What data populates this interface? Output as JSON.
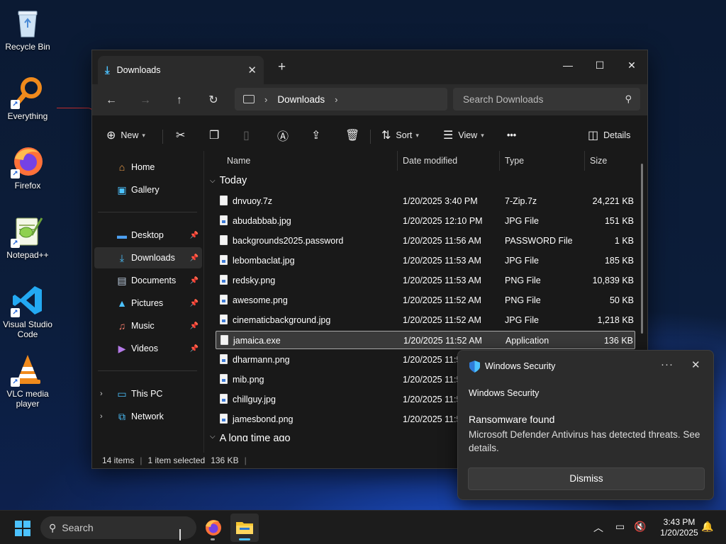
{
  "desktop": {
    "icons": [
      {
        "label": "Recycle Bin",
        "icon": "recycle-bin-icon"
      },
      {
        "label": "Everything",
        "icon": "everything-search-icon"
      },
      {
        "label": "Firefox",
        "icon": "firefox-icon"
      },
      {
        "label": "Notepad++",
        "icon": "notepad-plus-plus-icon"
      },
      {
        "label": "Visual Studio Code",
        "icon": "vscode-icon"
      },
      {
        "label": "VLC media player",
        "icon": "vlc-icon"
      }
    ]
  },
  "explorer": {
    "tab_title": "Downloads",
    "breadcrumb": [
      "Downloads"
    ],
    "search_placeholder": "Search Downloads",
    "toolbar": {
      "new_label": "New",
      "sort_label": "Sort",
      "view_label": "View",
      "details_label": "Details",
      "more_label": "•••"
    },
    "nav": {
      "home": "Home",
      "gallery": "Gallery",
      "desktop": "Desktop",
      "downloads": "Downloads",
      "documents": "Documents",
      "pictures": "Pictures",
      "music": "Music",
      "videos": "Videos",
      "this_pc": "This PC",
      "network": "Network"
    },
    "columns": {
      "name": "Name",
      "date": "Date modified",
      "type": "Type",
      "size": "Size"
    },
    "groups": {
      "today": "Today",
      "older": "A long time ago"
    },
    "files": [
      {
        "name": "dnvuoy.7z",
        "date": "1/20/2025 3:40 PM",
        "type": "7-Zip.7z",
        "size": "24,221 KB",
        "kind": "doc"
      },
      {
        "name": "abudabbab.jpg",
        "date": "1/20/2025 12:10 PM",
        "type": "JPG File",
        "size": "151 KB",
        "kind": "img"
      },
      {
        "name": "backgrounds2025.password",
        "date": "1/20/2025 11:56 AM",
        "type": "PASSWORD File",
        "size": "1 KB",
        "kind": "doc"
      },
      {
        "name": "lebombaclat.jpg",
        "date": "1/20/2025 11:53 AM",
        "type": "JPG File",
        "size": "185 KB",
        "kind": "img"
      },
      {
        "name": "redsky.png",
        "date": "1/20/2025 11:53 AM",
        "type": "PNG File",
        "size": "10,839 KB",
        "kind": "img"
      },
      {
        "name": "awesome.png",
        "date": "1/20/2025 11:52 AM",
        "type": "PNG File",
        "size": "50 KB",
        "kind": "img"
      },
      {
        "name": "cinematicbackground.jpg",
        "date": "1/20/2025 11:52 AM",
        "type": "JPG File",
        "size": "1,218 KB",
        "kind": "img"
      },
      {
        "name": "jamaica.exe",
        "date": "1/20/2025 11:52 AM",
        "type": "Application",
        "size": "136 KB",
        "kind": "doc",
        "selected": true
      },
      {
        "name": "dharmann.png",
        "date": "1/20/2025 11:5",
        "type": "",
        "size": "",
        "kind": "img"
      },
      {
        "name": "mib.png",
        "date": "1/20/2025 11:5",
        "type": "",
        "size": "",
        "kind": "img"
      },
      {
        "name": "chillguy.jpg",
        "date": "1/20/2025 11:5",
        "type": "",
        "size": "",
        "kind": "img"
      },
      {
        "name": "jamesbond.png",
        "date": "1/20/2025 11:5",
        "type": "",
        "size": "",
        "kind": "img"
      }
    ],
    "status": {
      "items": "14 items",
      "selected": "1 item selected",
      "size": "136 KB"
    }
  },
  "toast": {
    "app_name": "Windows Security",
    "subtitle": "Windows Security",
    "heading": "Ransomware found",
    "body": "Microsoft Defender Antivirus has detected threats. See details.",
    "button": "Dismiss",
    "more": "···",
    "close": "✕"
  },
  "taskbar": {
    "search_placeholder": "Search",
    "time": "3:43 PM",
    "date": "1/20/2025"
  },
  "colors": {
    "accent": "#4cc2ff",
    "window_bg": "#191919",
    "toast_bg": "#2c2c2c"
  }
}
